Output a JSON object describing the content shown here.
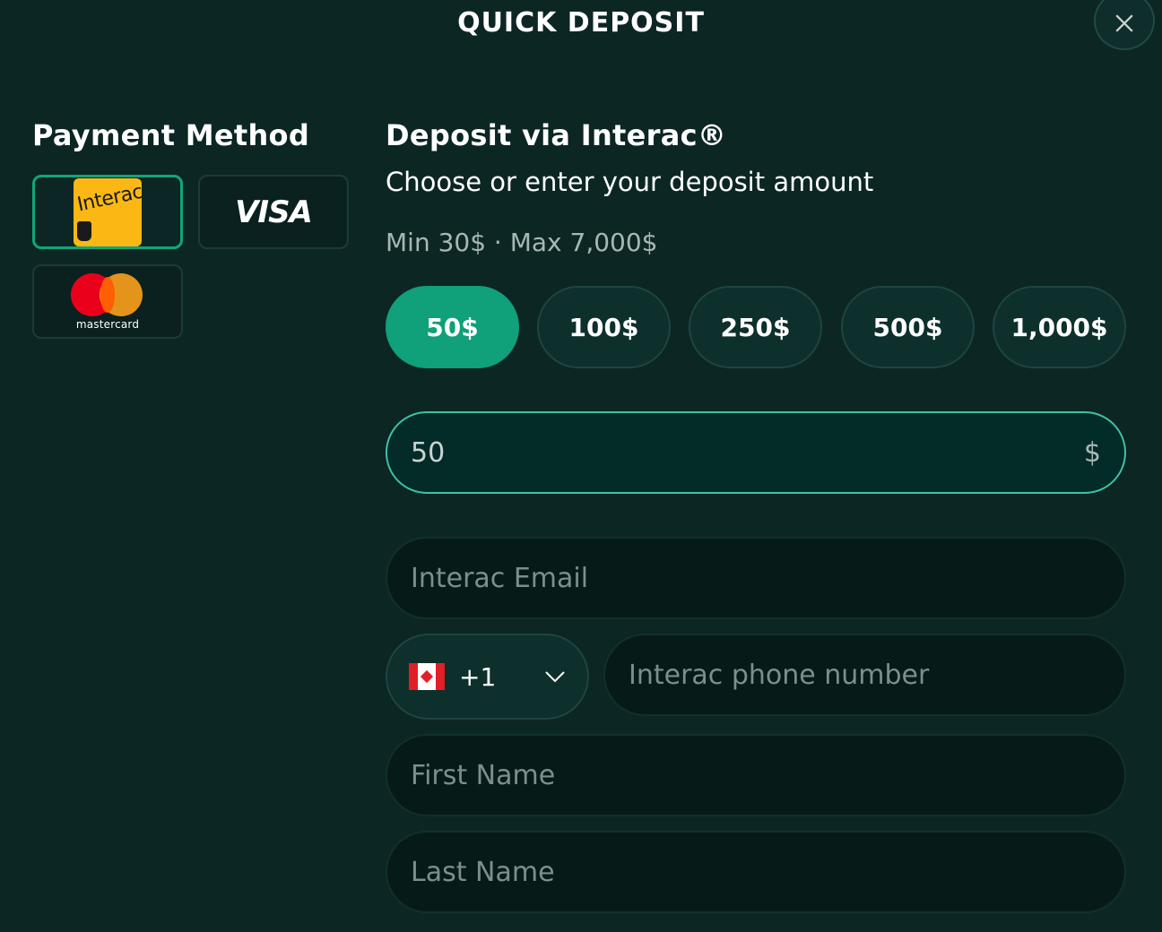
{
  "modal": {
    "title": "QUICK DEPOSIT",
    "close_icon": "close-icon"
  },
  "payment_method": {
    "heading": "Payment Method",
    "options": [
      {
        "id": "interac",
        "logo_text": "Interac",
        "selected": true
      },
      {
        "id": "visa",
        "logo_text": "VISA",
        "selected": false
      },
      {
        "id": "mastercard",
        "logo_text": "mastercard",
        "selected": false
      }
    ]
  },
  "deposit": {
    "heading": "Deposit via Interac®",
    "subtitle": "Choose or enter your deposit amount",
    "limits": "Min 30$ · Max 7,000$",
    "amounts": [
      "50$",
      "100$",
      "250$",
      "500$",
      "1,000$"
    ],
    "selected_amount_index": 0,
    "amount_value": "50",
    "currency_symbol": "$"
  },
  "form": {
    "email_placeholder": "Interac Email",
    "country_code": "+1",
    "country_flag": "canada-flag-icon",
    "phone_placeholder": "Interac phone number",
    "first_name_placeholder": "First Name",
    "last_name_placeholder": "Last Name"
  },
  "colors": {
    "background": "#0c2624",
    "accent": "#10a07a",
    "input_border_active": "#3fc2a4",
    "interac_yellow": "#fbb814"
  }
}
